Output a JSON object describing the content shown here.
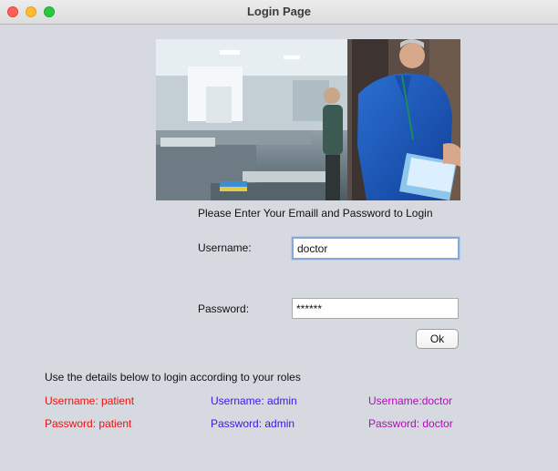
{
  "window": {
    "title": "Login Page"
  },
  "instruction": "Please Enter Your Emaill and Password to Login",
  "form": {
    "username_label": "Username:",
    "username_value": "doctor",
    "password_label": "Password:",
    "password_value": "******",
    "ok_label": "Ok"
  },
  "roles": {
    "heading": "Use the details below to login according to your roles",
    "patient": {
      "username": "Username: patient",
      "password": "Password: patient",
      "color": "#ee1111"
    },
    "admin": {
      "username": "Username: admin",
      "password": "Password: admin",
      "color": "#3a17e8"
    },
    "doctor": {
      "username": "Username:doctor",
      "password": "Password: doctor",
      "color": "#b20ab8"
    }
  },
  "icons": {
    "close": "close-icon",
    "minimize": "minimize-icon",
    "maximize": "maximize-icon"
  }
}
